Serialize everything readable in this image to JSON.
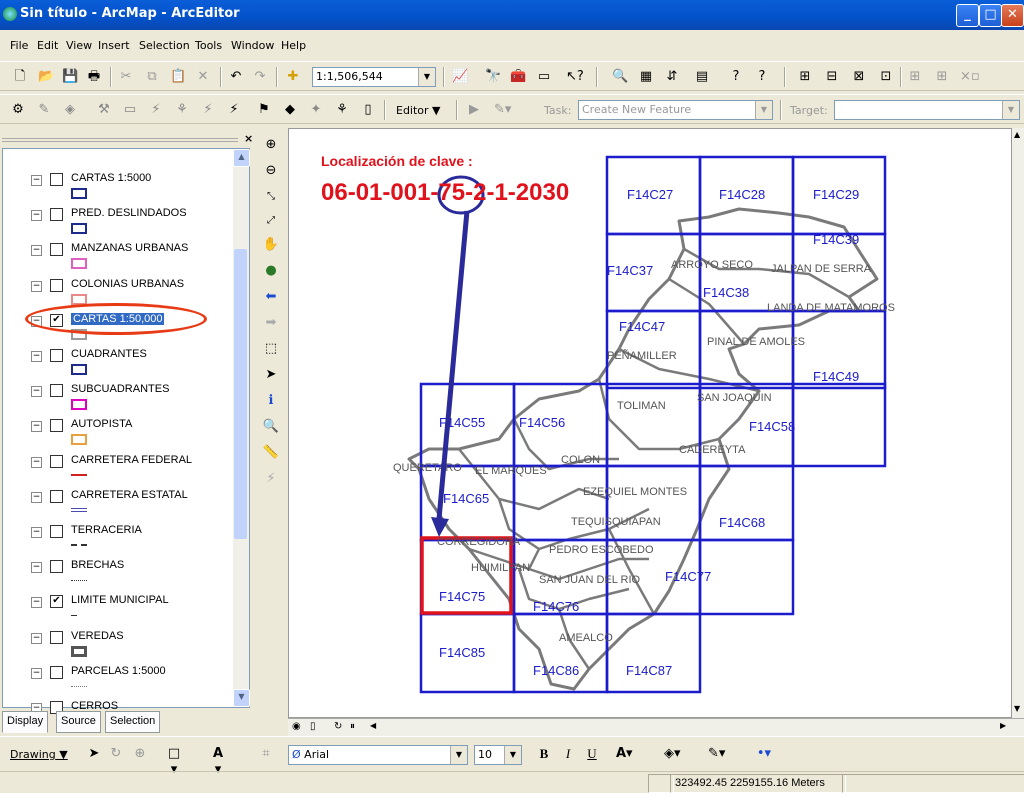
{
  "window": {
    "title": "Sin título - ArcMap - ArcEditor"
  },
  "menu": [
    "File",
    "Edit",
    "View",
    "Insert",
    "Selection",
    "Tools",
    "Window",
    "Help"
  ],
  "toolbar": {
    "scale": "1:1,506,544",
    "editor_label": "Editor",
    "task_label": "Task:",
    "task_value": "Create New Feature",
    "target_label": "Target:"
  },
  "toc": {
    "layers": [
      {
        "label": "CARTAS 1:5000",
        "checked": false
      },
      {
        "label": "PRED. DESLINDADOS",
        "checked": false
      },
      {
        "label": "MANZANAS URBANAS",
        "checked": false
      },
      {
        "label": "COLONIAS URBANAS",
        "checked": false
      },
      {
        "label": "CARTAS 1:50,000",
        "checked": true
      },
      {
        "label": "CUADRANTES",
        "checked": false
      },
      {
        "label": "SUBCUADRANTES",
        "checked": false
      },
      {
        "label": "AUTOPISTA",
        "checked": false
      },
      {
        "label": "CARRETERA FEDERAL",
        "checked": false
      },
      {
        "label": "CARRETERA ESTATAL",
        "checked": false
      },
      {
        "label": "TERRACERIA",
        "checked": false
      },
      {
        "label": "BRECHAS",
        "checked": false
      },
      {
        "label": "LIMITE MUNICIPAL",
        "checked": true
      },
      {
        "label": "VEREDAS",
        "checked": false
      },
      {
        "label": "PARCELAS 1:5000",
        "checked": false
      },
      {
        "label": "CERROS",
        "checked": false
      }
    ],
    "tabs": [
      "Display",
      "Source",
      "Selection"
    ]
  },
  "map": {
    "annotation_title": "Localización de clave :",
    "annotation_key": "06-01-001-75-2-1-2030",
    "sheets": [
      "F14C27",
      "F14C28",
      "F14C29",
      "F14C37",
      "F14C38",
      "F14C39",
      "F14C47",
      "F14C49",
      "F14C55",
      "F14C56",
      "F14C58",
      "F14C65",
      "F14C68",
      "F14C75",
      "F14C76",
      "F14C77",
      "F14C85",
      "F14C86",
      "F14C87"
    ],
    "municipios": [
      "ARROYO SECO",
      "JALPAN DE SERRA",
      "LANDA DE MATAMOROS",
      "PEÑAMILLER",
      "PINAL DE AMOLES",
      "TOLIMAN",
      "SAN JOAQUIN",
      "CADEREYTA",
      "QUERETARO",
      "EL MARQUES",
      "COLON",
      "EZEQUIEL MONTES",
      "TEQUISQUIAPAN",
      "CORREGIDORA",
      "PEDRO ESCOBEDO",
      "HUIMILPAN",
      "SAN JUAN DEL RIO",
      "AMEALCO"
    ],
    "colors": {
      "grid": "#1c1ccc",
      "limits": "#7a7a7a",
      "highlight": "#e0121b",
      "arrow": "#2a2a9a"
    }
  },
  "drawing": {
    "drawing_label": "Drawing",
    "font": "Arial",
    "size": "10"
  },
  "status": {
    "coords": "323492.45  2259155.16 Meters"
  }
}
